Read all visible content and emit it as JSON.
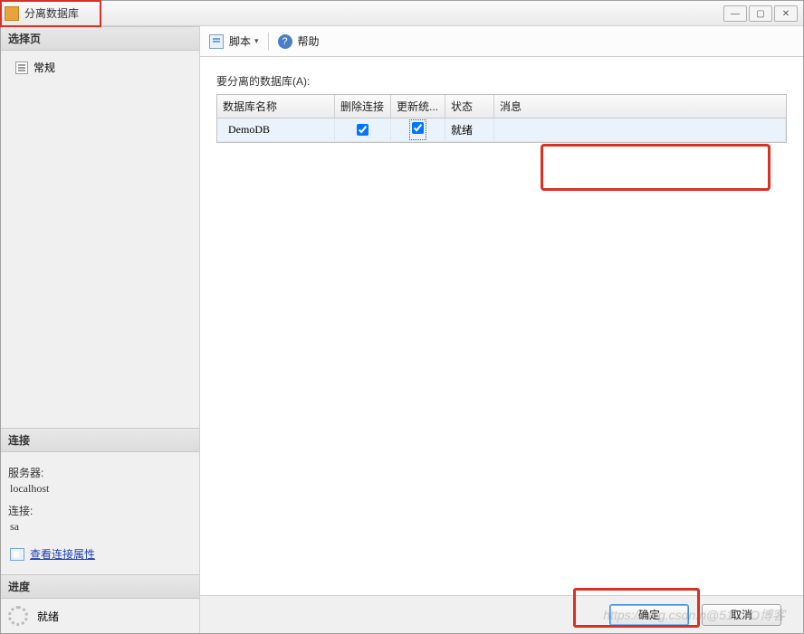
{
  "window": {
    "title": "分离数据库"
  },
  "sidebar": {
    "select_header": "选择页",
    "general_item": "常规",
    "connection_header": "连接",
    "server_label": "服务器:",
    "server_value": "localhost",
    "conn_label": "连接:",
    "conn_value": "sa",
    "view_props": "查看连接属性",
    "progress_header": "进度",
    "progress_status": "就绪"
  },
  "toolbar": {
    "script_label": "脚本",
    "help_label": "帮助"
  },
  "main": {
    "desc": "要分离的数据库(A):",
    "columns": {
      "name": "数据库名称",
      "drop": "删除连接",
      "update": "更新统...",
      "status": "状态",
      "message": "消息"
    },
    "rows": [
      {
        "name": "DemoDB",
        "status": "就绪"
      }
    ]
  },
  "footer": {
    "ok": "确定",
    "cancel": "取消"
  },
  "watermark": "https://blog.csdn.n@51CTO博客"
}
